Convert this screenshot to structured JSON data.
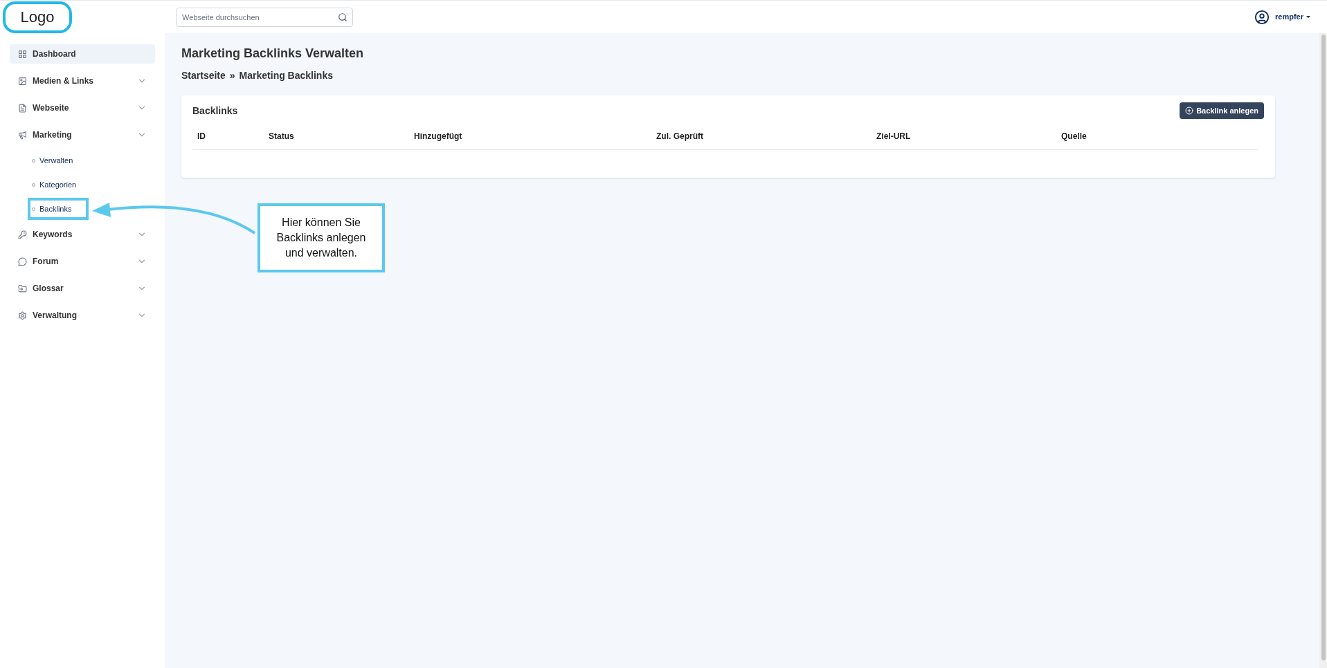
{
  "header": {
    "logo": "Logo",
    "search": {
      "placeholder": "Webseite durchsuchen"
    },
    "user": "rempfer"
  },
  "sidebar": {
    "items": [
      {
        "label": "Dashboard",
        "kind": "link",
        "selected": true
      },
      {
        "label": "Medien & Links",
        "kind": "group",
        "selected": false
      },
      {
        "label": "Webseite",
        "kind": "group",
        "selected": false
      },
      {
        "label": "Marketing",
        "kind": "group",
        "selected": false,
        "children": [
          {
            "label": "Verwalten",
            "highlighted": false
          },
          {
            "label": "Kategorien",
            "highlighted": false
          },
          {
            "label": "Backlinks",
            "highlighted": true
          }
        ]
      },
      {
        "label": "Keywords",
        "kind": "group",
        "selected": false
      },
      {
        "label": "Forum",
        "kind": "group",
        "selected": false
      },
      {
        "label": "Glossar",
        "kind": "group",
        "selected": false
      },
      {
        "label": "Verwaltung",
        "kind": "group",
        "selected": false
      }
    ]
  },
  "page": {
    "title": "Marketing Backlinks Verwalten",
    "breadcrumb": [
      "Startseite",
      "»",
      "Marketing Backlinks"
    ]
  },
  "card": {
    "title": "Backlinks",
    "button": "Backlink anlegen",
    "table": {
      "columns": [
        "ID",
        "Status",
        "Hinzugefügt",
        "Zul. Geprüft",
        "Ziel-URL",
        "Quelle"
      ]
    }
  },
  "annotation": {
    "text": "Hier können Sie Backlinks anlegen und verwalten."
  }
}
